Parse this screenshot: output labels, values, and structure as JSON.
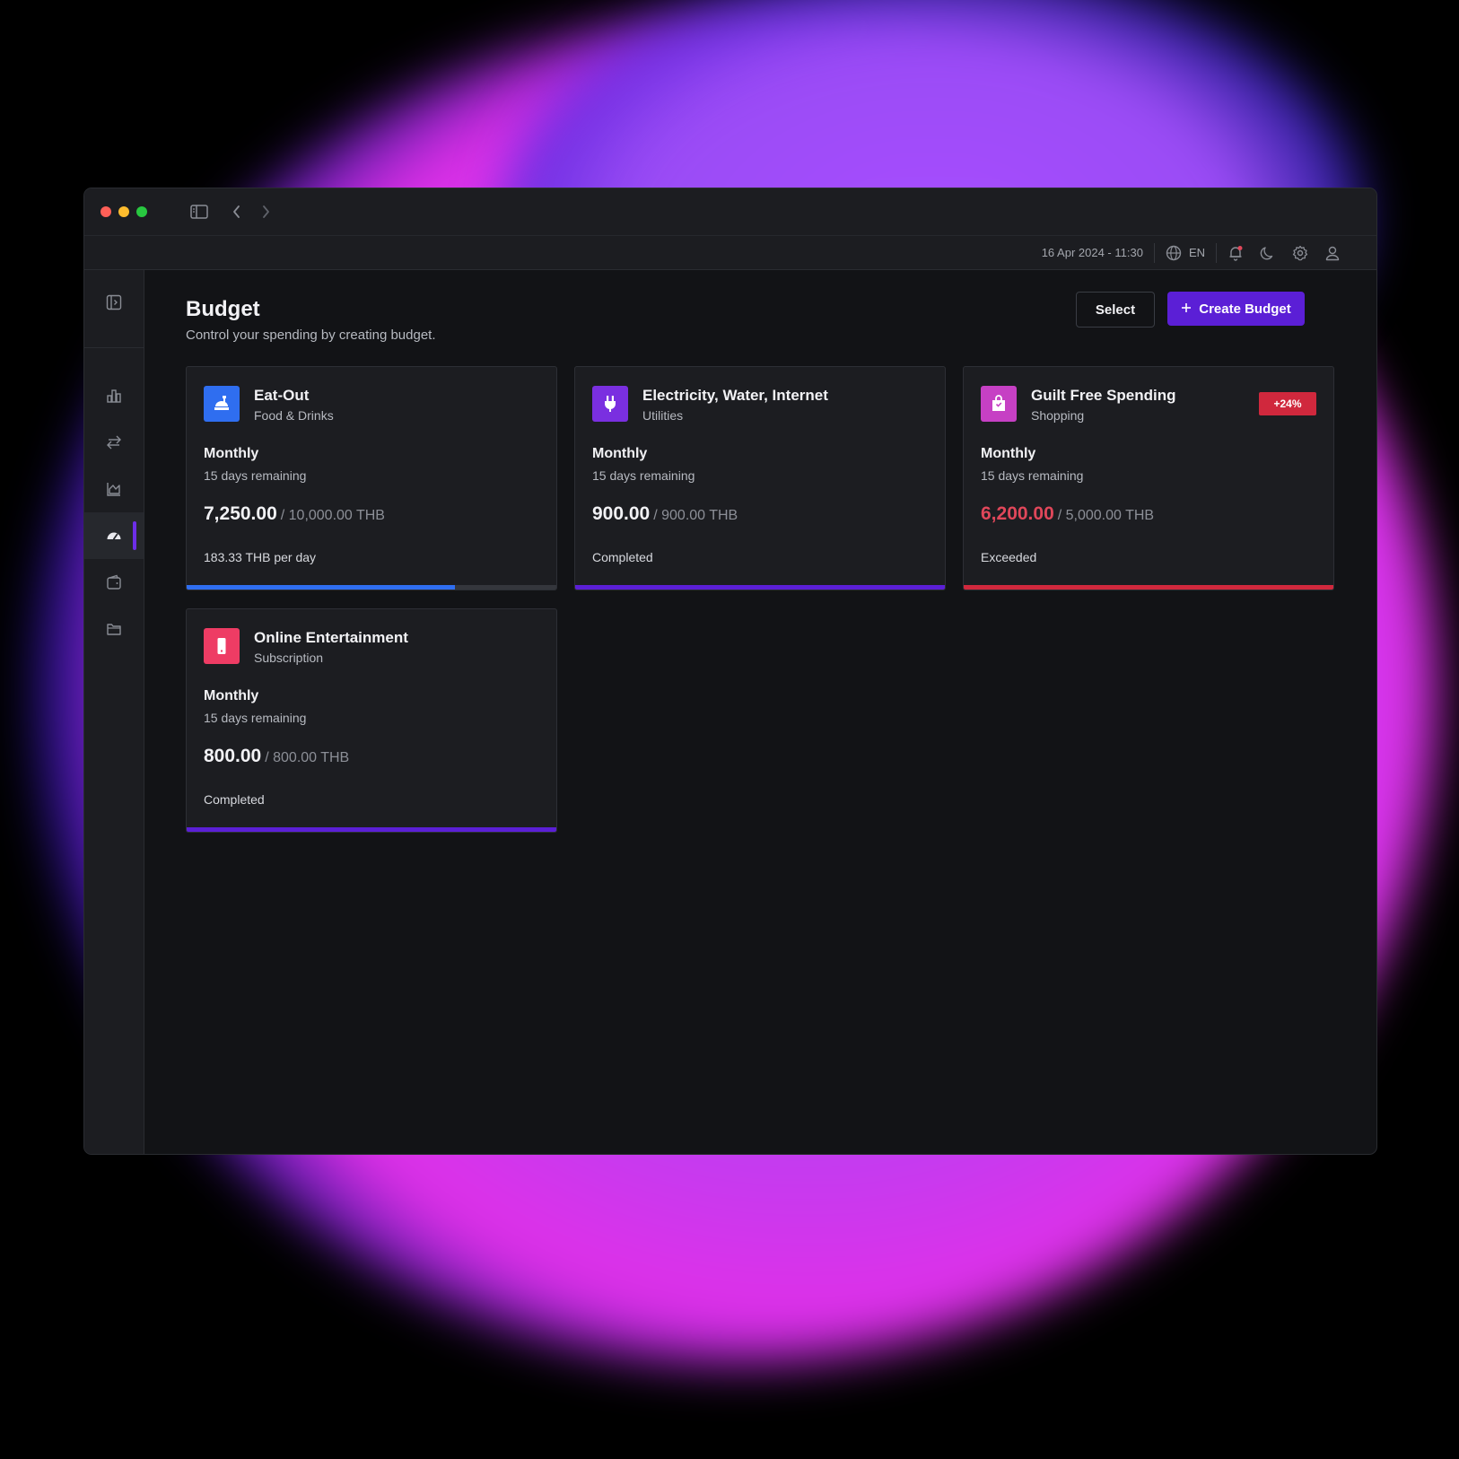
{
  "topbar": {
    "datetime": "16 Apr 2024 - 11:30",
    "language": "EN"
  },
  "page": {
    "title": "Budget",
    "subtitle": "Control your spending by creating budget.",
    "select_label": "Select",
    "create_label": "Create Budget"
  },
  "colors": {
    "accent": "#5b1fd6",
    "exceeded": "#d0283d",
    "eat_out": "#2f6ef0",
    "utilities": "#7a2fe0",
    "shopping": "#c640c4",
    "entertainment": "#ee3c64"
  },
  "budgets": [
    {
      "name": "Eat-Out",
      "category": "Food & Drinks",
      "icon": "food-icon",
      "period": "Monthly",
      "remaining": "15 days remaining",
      "spent": "7,250.00",
      "total": "/ 10,000.00 THB",
      "status": "183.33 THB per day",
      "progress": 0.725
    },
    {
      "name": "Electricity, Water, Internet",
      "category": "Utilities",
      "icon": "plug-icon",
      "period": "Monthly",
      "remaining": "15 days remaining",
      "spent": "900.00",
      "total": "/ 900.00 THB",
      "status": "Completed",
      "progress": 1.0
    },
    {
      "name": "Guilt Free Spending",
      "category": "Shopping",
      "icon": "shopping-bag-icon",
      "period": "Monthly",
      "remaining": "15 days remaining",
      "spent": "6,200.00",
      "total": "/ 5,000.00 THB",
      "status": "Exceeded",
      "badge": "+24%",
      "progress": 1.0
    },
    {
      "name": "Online Entertainment",
      "category": "Subscription",
      "icon": "phone-icon",
      "period": "Monthly",
      "remaining": "15 days remaining",
      "spent": "800.00",
      "total": "/ 800.00 THB",
      "status": "Completed",
      "progress": 1.0
    }
  ]
}
